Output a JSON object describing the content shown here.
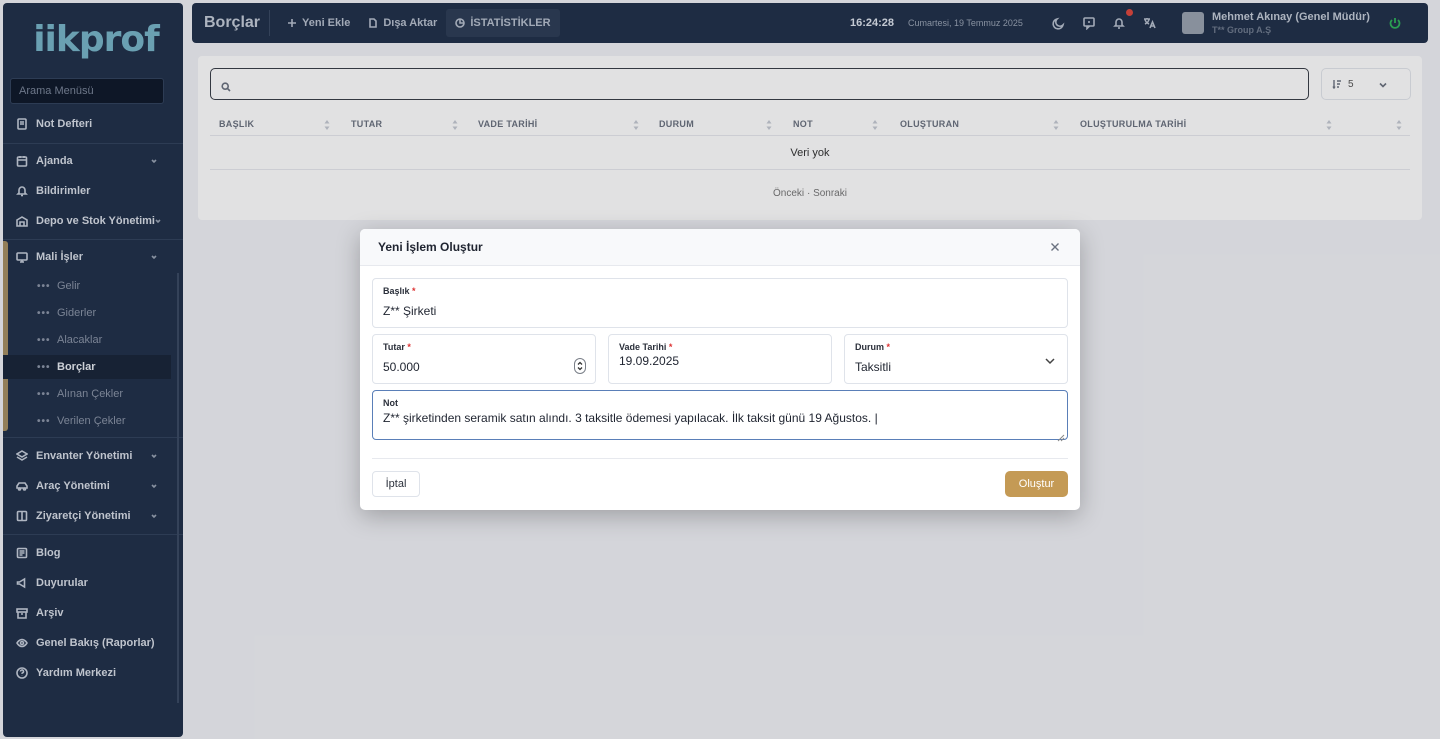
{
  "sidebar": {
    "logo_text": "iikprof",
    "search_placeholder": "Arama Menüsü",
    "items": [
      {
        "label": "Not Defteri",
        "icon": "notebook-icon"
      },
      {
        "label": "Ajanda",
        "icon": "calendar-icon"
      },
      {
        "label": "Bildirimler",
        "icon": "bell-icon"
      },
      {
        "label": "Depo ve Stok Yönetimi",
        "icon": "warehouse-icon"
      },
      {
        "label": "Mali İşler",
        "icon": "finance-icon"
      },
      {
        "label": "Envanter Yönetimi",
        "icon": "layers-icon"
      },
      {
        "label": "Araç Yönetimi",
        "icon": "car-icon"
      },
      {
        "label": "Ziyaretçi Yönetimi",
        "icon": "book-icon"
      },
      {
        "label": "Blog",
        "icon": "blog-icon"
      },
      {
        "label": "Duyurular",
        "icon": "megaphone-icon"
      },
      {
        "label": "Arşiv",
        "icon": "archive-icon"
      },
      {
        "label": "Genel Bakış (Raporlar)",
        "icon": "eye-icon"
      },
      {
        "label": "Yardım Merkezi",
        "icon": "help-icon"
      }
    ],
    "sub_items": [
      "Gelir",
      "Giderler",
      "Alacaklar",
      "Borçlar",
      "Alınan Çekler",
      "Verilen Çekler"
    ],
    "active_sub": "Borçlar"
  },
  "topbar": {
    "page_title": "Borçlar",
    "add_new": "Yeni Ekle",
    "export": "Dışa Aktar",
    "statistics": "İSTATİSTİKLER",
    "time": "16:24:28",
    "date": "Cumartesi, 19 Temmuz 2025",
    "user_name": "Mehmet Akınay (Genel Müdür)",
    "user_company": "T** Group A.Ş"
  },
  "table": {
    "search_value": "",
    "page_size": "5",
    "columns": [
      "BAŞLIK",
      "TUTAR",
      "VADE TARİHİ",
      "DURUM",
      "NOT",
      "OLUŞTURAN",
      "OLUŞTURULMA TARİHİ"
    ],
    "empty_text": "Veri yok",
    "prev": "Önceki",
    "next": "Sonraki",
    "pager_sep": "·"
  },
  "modal": {
    "title": "Yeni İşlem Oluştur",
    "required_mark": "*",
    "baslik_label": "Başlık",
    "baslik_value": "Z** Şirketi",
    "tutar_label": "Tutar",
    "tutar_value": "50.000",
    "vade_label": "Vade Tarihi",
    "vade_value": "19.09.2025",
    "durum_label": "Durum",
    "durum_value": "Taksitli",
    "not_label": "Not",
    "not_value": "Z** şirketinden seramik satın alındı. 3 taksitle ödemesi yapılacak. İlk taksit günü 19 Ağustos. |",
    "cancel": "İptal",
    "create": "Oluştur"
  },
  "colors": {
    "sidebar_bg": "#22314a",
    "accent_gold": "#c49a55",
    "page_bg": "#f1f2f6"
  }
}
